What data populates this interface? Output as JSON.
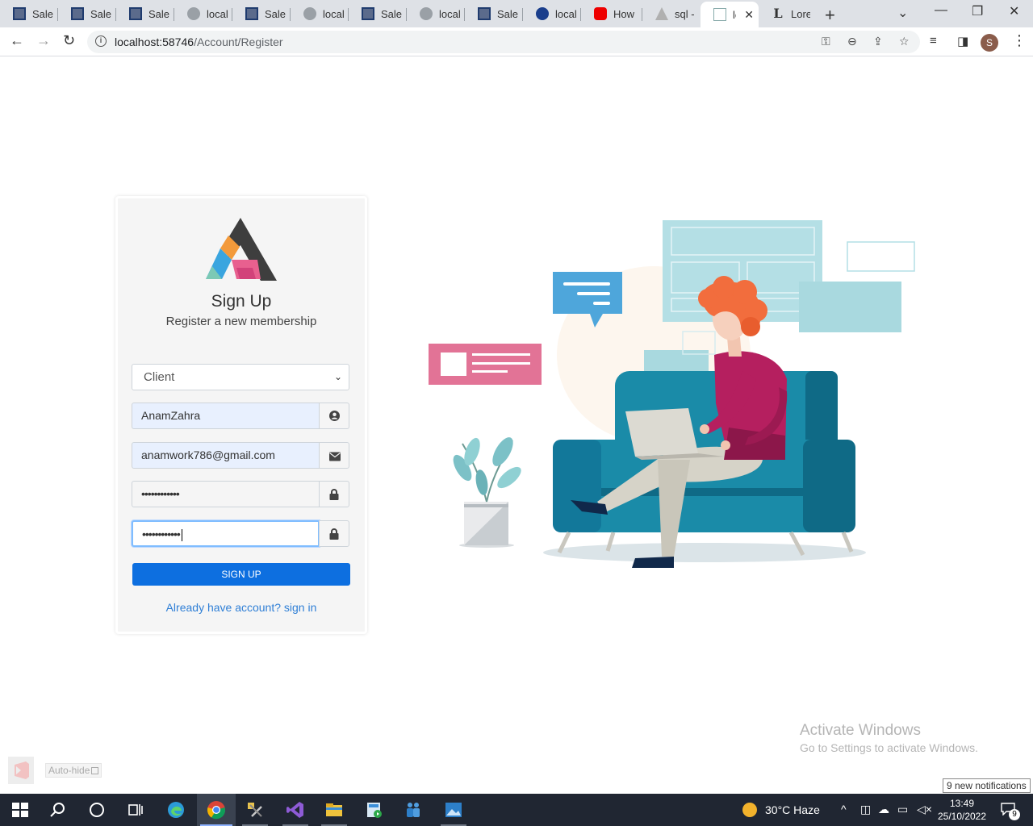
{
  "browser": {
    "tabs": [
      {
        "title": "Sales",
        "icon": "sales-icon"
      },
      {
        "title": "Sales",
        "icon": "sales-icon"
      },
      {
        "title": "Sales",
        "icon": "sales-icon"
      },
      {
        "title": "localh",
        "icon": "globe-icon"
      },
      {
        "title": "Sales",
        "icon": "sales-icon"
      },
      {
        "title": "localh",
        "icon": "globe-icon"
      },
      {
        "title": "Sales",
        "icon": "sales-icon"
      },
      {
        "title": "localh",
        "icon": "globe-icon"
      },
      {
        "title": "Sales",
        "icon": "sales-icon"
      },
      {
        "title": "localh",
        "icon": "chrome-icon"
      },
      {
        "title": "How",
        "icon": "youtube-icon"
      },
      {
        "title": "sql -",
        "icon": "sql-icon"
      },
      {
        "title": "lo",
        "icon": "document-icon",
        "active": true
      },
      {
        "title": "Lorem",
        "icon": "l-icon"
      }
    ],
    "url_host": "localhost:58746",
    "url_path": "/Account/Register",
    "profile_initial": "S"
  },
  "form": {
    "title": "Sign Up",
    "subtitle": "Register a new membership",
    "role_value": "Client",
    "username_value": "AnamZahra",
    "email_value": "anamwork786@gmail.com",
    "password_value": "••••••••••••",
    "confirm_password_value": "••••••••••••",
    "submit_label": "SIGN UP",
    "signin_link": "Already have account? sign in"
  },
  "overlay": {
    "activate_title": "Activate Windows",
    "activate_sub": "Go to Settings to activate Windows.",
    "autohide_label": "Auto-hide",
    "notification_tip": "9 new notifications"
  },
  "taskbar": {
    "weather": "30°C  Haze",
    "time": "13:49",
    "date": "25/10/2022",
    "notification_count": "9"
  },
  "colors": {
    "primary": "#0d6fe0",
    "link": "#2f7fd6",
    "teal": "#1a8ba8",
    "pink": "#e27396",
    "hair": "#f26d3d"
  }
}
